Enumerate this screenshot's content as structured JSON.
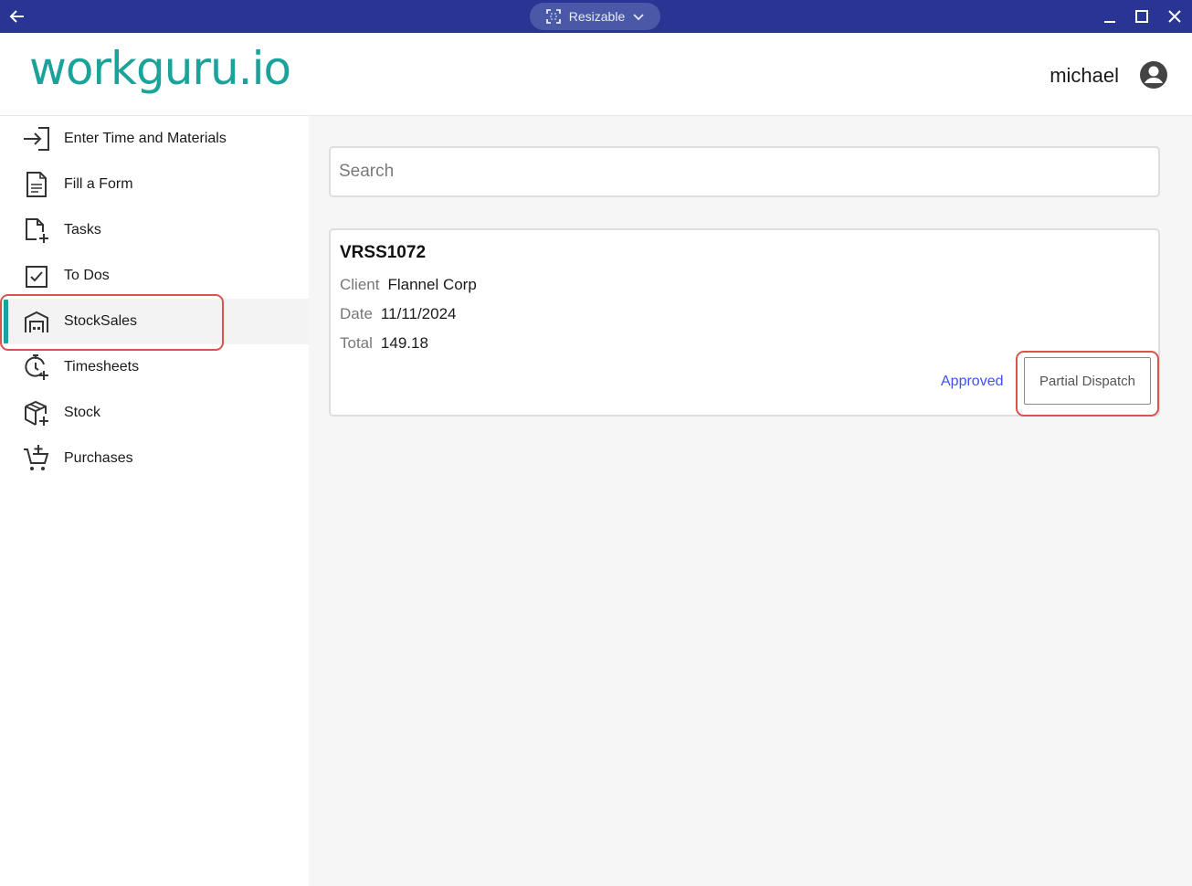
{
  "titlebar": {
    "mode_label": "Resizable"
  },
  "header": {
    "logo_text": "workguru.io",
    "username": "michael"
  },
  "sidebar": {
    "items": [
      {
        "label": "Enter Time and Materials",
        "icon": "enter-arrow-icon"
      },
      {
        "label": "Fill a Form",
        "icon": "document-icon"
      },
      {
        "label": "Tasks",
        "icon": "task-add-icon"
      },
      {
        "label": "To Dos",
        "icon": "checkbox-icon"
      },
      {
        "label": "StockSales",
        "icon": "warehouse-icon",
        "active": true
      },
      {
        "label": "Timesheets",
        "icon": "stopwatch-icon"
      },
      {
        "label": "Stock",
        "icon": "package-icon"
      },
      {
        "label": "Purchases",
        "icon": "cart-add-icon"
      }
    ]
  },
  "search": {
    "placeholder": "Search",
    "value": ""
  },
  "stocksale": {
    "number": "VRSS1072",
    "client_label": "Client",
    "client": "Flannel Corp",
    "date_label": "Date",
    "date": "11/11/2024",
    "total_label": "Total",
    "total": "149.18",
    "status": "Approved",
    "action_label": "Partial Dispatch"
  },
  "colors": {
    "titlebar": "#283593",
    "brand": "#1aa39a",
    "link": "#3f51f5",
    "highlight": "#d9534f"
  }
}
